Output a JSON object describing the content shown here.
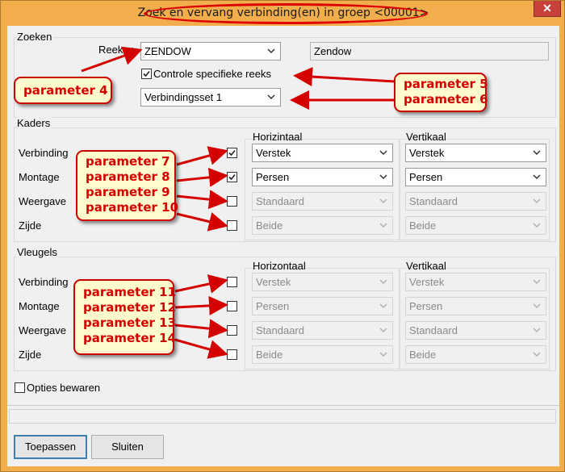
{
  "window": {
    "title": "Zoek en vervang verbinding(en) in groep <00001>",
    "close_glyph": "✕"
  },
  "zoeken": {
    "group_label": "Zoeken",
    "reeks_label": "Reeks :",
    "reeks_value": "ZENDOW",
    "reeks_description": "Zendow",
    "controle_label": "Controle specifieke reeks",
    "controle_checked": true,
    "set_value": "Verbindingsset 1"
  },
  "kaders": {
    "group_label": "Kaders",
    "horizontal_header": "Horizintaal",
    "vertical_header": "Vertikaal",
    "rows": [
      {
        "label": "Verbinding",
        "checked": true,
        "horizontal": "Verstek",
        "vertical": "Verstek",
        "enabled": true
      },
      {
        "label": "Montage",
        "checked": true,
        "horizontal": "Persen",
        "vertical": "Persen",
        "enabled": true
      },
      {
        "label": "Weergave",
        "checked": false,
        "horizontal": "Standaard",
        "vertical": "Standaard",
        "enabled": false
      },
      {
        "label": "Zijde",
        "checked": false,
        "horizontal": "Beide",
        "vertical": "Beide",
        "enabled": false
      }
    ]
  },
  "vleugels": {
    "group_label": "Vleugels",
    "horizontal_header": "Horizontaal",
    "vertical_header": "Vertikaal",
    "rows": [
      {
        "label": "Verbinding",
        "checked": false,
        "horizontal": "Verstek",
        "vertical": "Verstek",
        "enabled": false
      },
      {
        "label": "Montage",
        "checked": false,
        "horizontal": "Persen",
        "vertical": "Persen",
        "enabled": false
      },
      {
        "label": "Weergave",
        "checked": false,
        "horizontal": "Standaard",
        "vertical": "Standaard",
        "enabled": false
      },
      {
        "label": "Zijde",
        "checked": false,
        "horizontal": "Beide",
        "vertical": "Beide",
        "enabled": false
      }
    ]
  },
  "opties_label": "Opties bewaren",
  "opties_checked": false,
  "buttons": {
    "apply": "Toepassen",
    "close": "Sluiten"
  },
  "annotations": {
    "p4": [
      "parameter 4"
    ],
    "p56": [
      "parameter 5",
      "parameter 6"
    ],
    "p7_10": [
      "parameter 7",
      "parameter 8",
      "parameter 9",
      "parameter 10"
    ],
    "p11_14": [
      "parameter 11",
      "parameter 12",
      "parameter 13",
      "parameter 14"
    ]
  },
  "colors": {
    "titlebar": "#f2ae4c",
    "annotation_red": "#d40000",
    "callout_bg": "#fffbcc",
    "close_button": "#c7413a"
  }
}
